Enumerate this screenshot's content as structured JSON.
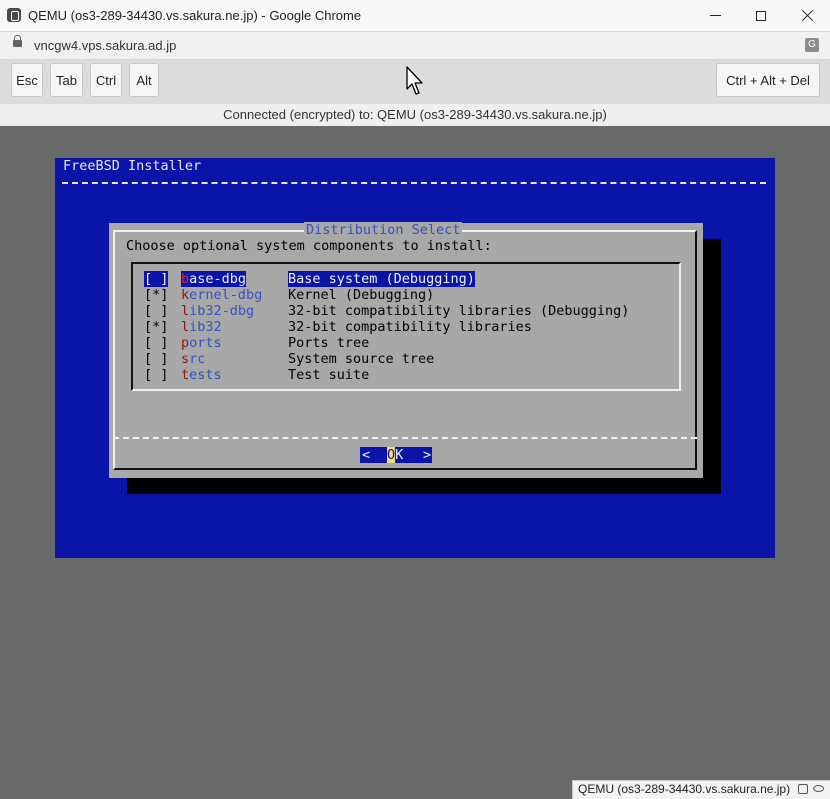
{
  "window": {
    "title": "QEMU (os3-289-34430.vs.sakura.ne.jp) - Google Chrome",
    "url": "vncgw4.vps.sakura.ad.jp"
  },
  "toolbar": {
    "esc_label": "Esc",
    "tab_label": "Tab",
    "ctrl_label": "Ctrl",
    "alt_label": "Alt",
    "cad_label": "Ctrl + Alt + Del"
  },
  "status": {
    "connection_text": "Connected (encrypted) to: QEMU (os3-289-34430.vs.sakura.ne.jp)"
  },
  "installer": {
    "title": "FreeBSD Installer",
    "dialog_title": "Distribution Select",
    "prompt": "Choose optional system components to install:",
    "items": [
      {
        "check": "[ ]",
        "hotkey": "b",
        "rest": "ase-dbg",
        "desc": "Base system (Debugging)",
        "selected": true
      },
      {
        "check": "[*]",
        "hotkey": "k",
        "rest": "ernel-dbg",
        "desc": "Kernel (Debugging)",
        "selected": false
      },
      {
        "check": "[ ]",
        "hotkey": "l",
        "rest": "ib32-dbg",
        "desc": "32-bit compatibility libraries (Debugging)",
        "selected": false
      },
      {
        "check": "[*]",
        "hotkey": "l",
        "rest": "ib32",
        "desc": "32-bit compatibility libraries",
        "selected": false
      },
      {
        "check": "[ ]",
        "hotkey": "p",
        "rest": "orts",
        "desc": "Ports tree",
        "selected": false
      },
      {
        "check": "[ ]",
        "hotkey": "s",
        "rest": "rc",
        "desc": "System source tree",
        "selected": false
      },
      {
        "check": "[ ]",
        "hotkey": "t",
        "rest": "ests",
        "desc": "Test suite",
        "selected": false
      }
    ],
    "ok": {
      "left": "<",
      "hotkey": "O",
      "rest": "K",
      "right": ">"
    }
  },
  "bottom_tab": {
    "text": "QEMU (os3-289-34430.vs.sakura.ne.jp)"
  }
}
